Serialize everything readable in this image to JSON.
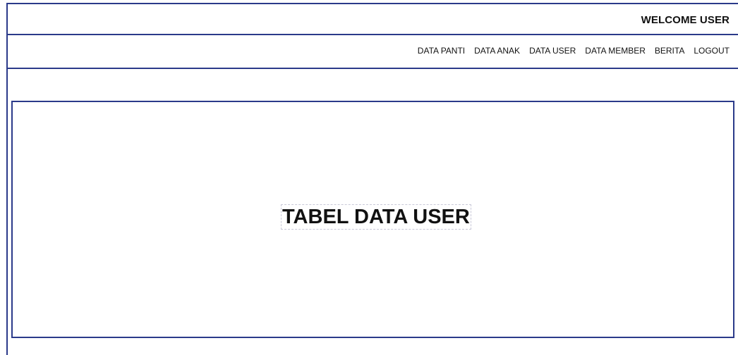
{
  "header": {
    "welcome_text": "WELCOME USER"
  },
  "nav": {
    "items": [
      {
        "label": "DATA PANTI"
      },
      {
        "label": "DATA ANAK"
      },
      {
        "label": "DATA USER"
      },
      {
        "label": "DATA MEMBER"
      },
      {
        "label": "BERITA"
      },
      {
        "label": "LOGOUT"
      }
    ]
  },
  "main": {
    "table_title": "TABEL DATA USER"
  },
  "colors": {
    "border": "#2b3a8a"
  }
}
